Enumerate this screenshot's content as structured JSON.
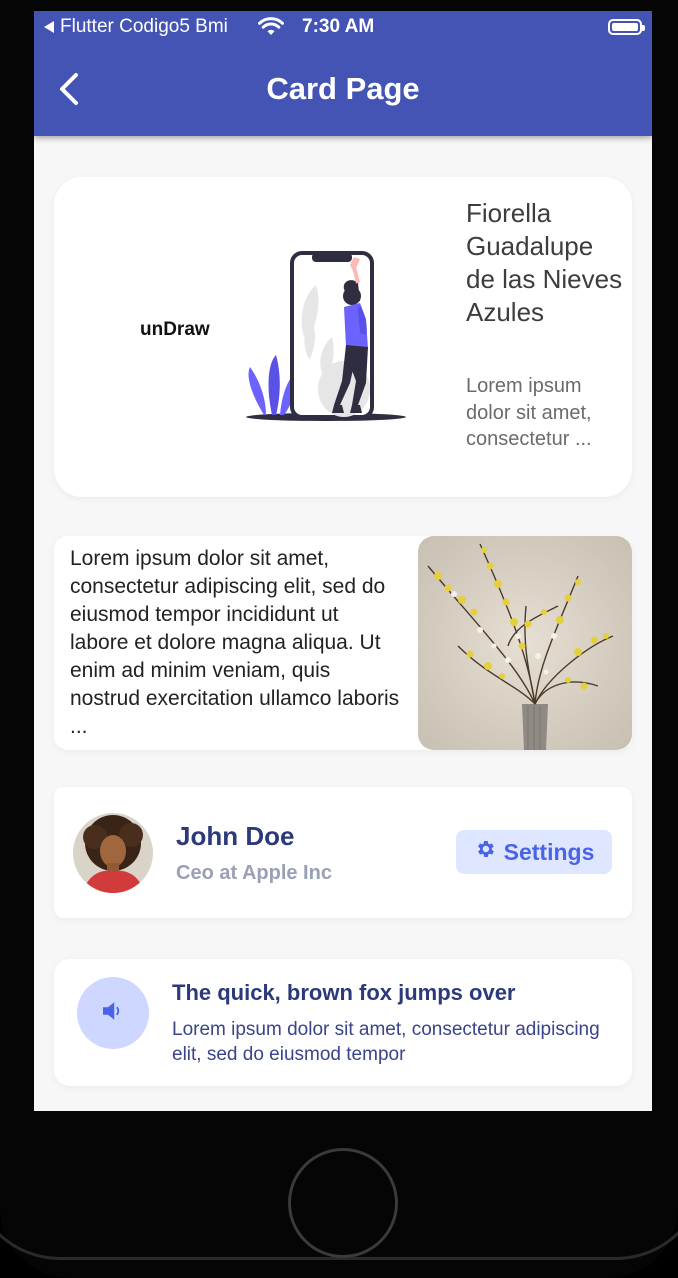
{
  "status": {
    "back_app_label": "Flutter Codigo5 Bmi",
    "time": "7:30 AM"
  },
  "appbar": {
    "title": "Card Page"
  },
  "card1": {
    "illustration_brand": "unDraw",
    "name": "Fiorella Guadalupe de las Nieves Azules",
    "description": "Lorem ipsum dolor sit amet, consectetur ..."
  },
  "card2": {
    "text": "Lorem ipsum dolor sit amet, consectetur adipiscing elit, sed do eiusmod tempor incididunt ut labore et dolore magna aliqua. Ut enim ad minim veniam, quis nostrud exercitation ullamco laboris ..."
  },
  "card3": {
    "name": "John Doe",
    "role": "Ceo at Apple Inc",
    "settings_label": "Settings"
  },
  "card4": {
    "title": "The quick, brown fox jumps over",
    "body": "Lorem ipsum dolor sit amet, consectetur adipiscing elit, sed do eiusmod tempor"
  },
  "icons": {
    "back": "back-arrow-icon",
    "wifi": "wifi-icon",
    "battery": "battery-icon",
    "settings": "gear-icon",
    "volume": "volume-icon"
  },
  "colors": {
    "appbar": "#4354b5",
    "accent": "#4b64e6",
    "accent_bg": "#dfe6ff",
    "title_dark": "#2d3a7a"
  }
}
